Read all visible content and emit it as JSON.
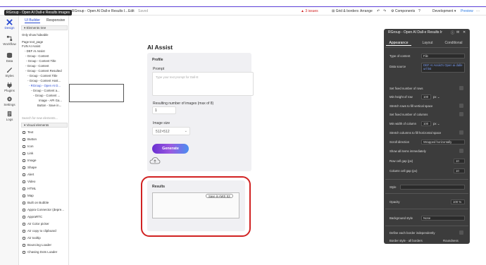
{
  "topbar": {
    "tooltip": "RGroup - Open AI Dall-e Results images",
    "page_name": "RGroup - Open AI Dall-e Results I...",
    "edit": "Edit",
    "saved": "Saved",
    "issues": "3 issues",
    "grid": "Grid & borders",
    "arrange": "Arrange",
    "components": "Components",
    "development": "Development",
    "preview": "Preview"
  },
  "rail": [
    "Design",
    "Workflow",
    "Data",
    "Styles",
    "Plugins",
    "Settings",
    "Logs"
  ],
  "panel": {
    "tab_ui": "UI Builder",
    "tab_responsive": "Responsive",
    "elements_tree": "Elements tree",
    "only_hideable": "Only show hideable",
    "tree": [
      "Page text_page",
      "FUN AI Assist",
      "- DEF AI Assist",
      "- Group - Content",
      "- Group - Content Title",
      "- Group - Content",
      "- Group - Content Resulted",
      "- Group - Content Title",
      "- Group - Content Host...",
      "- RGroup - Open AI D...",
      "- Group - Content a...",
      "- Group - Content ...",
      "Image - API Ga...",
      "Button - Save in..."
    ],
    "search": "Search for new elements...",
    "visual_header": "Visual elements",
    "visual": [
      "Text",
      "Button",
      "Icon",
      "Link",
      "Image",
      "Shape",
      "Alert",
      "Video",
      "HTML",
      "Map",
      "Built on Bubble",
      "Appra Connector (depre...",
      "AppraRTC",
      "Air Color picker",
      "Air copy to clipboard",
      "Air tooltip",
      "Bouncing Loader",
      "Chasing Dots Loader"
    ]
  },
  "canvas": {
    "title": "AI Assist",
    "profile": "Profile",
    "prompt_label": "Prompt",
    "prompt_placeholder": "Type your text prompt for Dall-E",
    "num_label": "Resulting number of images (max of 8)",
    "num_value": "1",
    "size_label": "Image size",
    "size_value": "512×512",
    "generate": "Generate",
    "results": "Results",
    "save_badge": "Save in AWS S3"
  },
  "editor": {
    "title": "RGroup - Open AI Dall-e Results Ir",
    "tabs": [
      "Appearance",
      "Layout",
      "Conditional"
    ],
    "type_label": "Type of content",
    "type_value": "File",
    "source_label": "Data source",
    "source_value": "DEF AI Assist's Open ai dalle url list",
    "rows": [
      {
        "label": "Set fixed number of rows"
      },
      {
        "label": "Min height of row",
        "value": "100",
        "unit": "px"
      },
      {
        "label": "Stretch rows to fill vertical space"
      },
      {
        "label": "Set fixed number of columns"
      },
      {
        "label": "Min width of column",
        "value": "100",
        "unit": "px"
      },
      {
        "label": "Stretch columns to fill horizontal space"
      },
      {
        "label": "Scroll direction",
        "value": "Wrapped horizontally"
      },
      {
        "label": "Show all items immediately"
      },
      {
        "label": "Row cell gap (px)",
        "value": "10"
      },
      {
        "label": "Column cell gap (px)",
        "value": "10"
      }
    ],
    "style_label": "Style",
    "opacity_label": "Opacity",
    "opacity_value": "100 %",
    "bg_label": "Background style",
    "bg_value": "None",
    "border_indep": "Define each border independently",
    "border_style": "Border style - all borders",
    "roundness": "Roundness"
  },
  "colors": {
    "accent": "#5b3fd6",
    "danger": "#d12222",
    "preview": "#2a7ae2"
  }
}
